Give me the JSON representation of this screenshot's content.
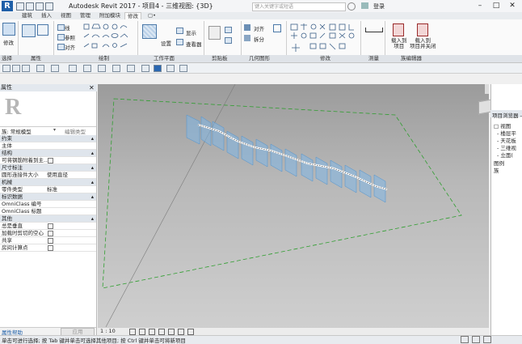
{
  "titlebar": {
    "app_letter": "R",
    "title": "Autodesk Revit 2017 -   项目4 - 三维视图: {3D}",
    "search_placeholder": "键入关键字或短语",
    "user": "登录",
    "min": "–",
    "max": "□",
    "close": "✕"
  },
  "tabs": [
    "建筑",
    "插入",
    "视图",
    "管理",
    "附加模块",
    "修改",
    "▢•"
  ],
  "ribbon": {
    "modify_label": "修改",
    "draw_items": [
      "线",
      "参照",
      "对齐"
    ],
    "workplane_items": [
      "设置",
      "显示",
      "查看器"
    ],
    "measure_items": [
      "对齐",
      "拆分",
      "修剪"
    ],
    "load_family": "载入到\n项目",
    "load_close": "载入到\n项目并关闭",
    "panels": [
      "选择",
      "属性",
      "绘制",
      "工作平面",
      "剪贴板",
      "几何图形",
      "修改",
      "测量",
      "族编辑器"
    ]
  },
  "properties": {
    "title": "属性",
    "type_selector": "族: 常规模型",
    "edit_type": "编辑类型",
    "rows": [
      {
        "cat": true,
        "k": "约束"
      },
      {
        "k": "主体",
        "v": ""
      },
      {
        "cat": true,
        "k": "结构"
      },
      {
        "k": "可将钢筋附着到主...",
        "check": true
      },
      {
        "cat": true,
        "k": "尺寸标注"
      },
      {
        "k": "圆形连接件大小",
        "v": "使用直径"
      },
      {
        "cat": true,
        "k": "机械"
      },
      {
        "k": "零件类型",
        "v": "标准"
      },
      {
        "cat": true,
        "k": "标识数据"
      },
      {
        "k": "OmniClass 编号",
        "v": ""
      },
      {
        "k": "OmniClass 标题",
        "v": ""
      },
      {
        "cat": true,
        "k": "其他"
      },
      {
        "k": "总是垂直",
        "check": true
      },
      {
        "k": "加载时剪切的空心",
        "check": true
      },
      {
        "k": "共享",
        "check": true
      },
      {
        "k": "房间计算点",
        "check": true
      }
    ],
    "help": "属性帮助",
    "apply": "应用"
  },
  "browser": {
    "title": "项目浏览器 - 项目4",
    "items": [
      "□ 视图",
      "- 楼层平",
      "- 天花板",
      "- 三维视",
      "- 立面(",
      "图例",
      "族"
    ]
  },
  "viewbar": {
    "scale": "1 : 10"
  },
  "status": {
    "text": "单击可进行选择; 按 Tab 键并单击可选择其他项目; 按 Ctrl 键并单击可将新项目"
  },
  "colors": {
    "accent": "#1e5fa8",
    "canvas_top": "#9b9b9b",
    "green_boundary": "#2f9e2f",
    "path_line": "#ffffff",
    "frame": "#7fb7e6"
  }
}
